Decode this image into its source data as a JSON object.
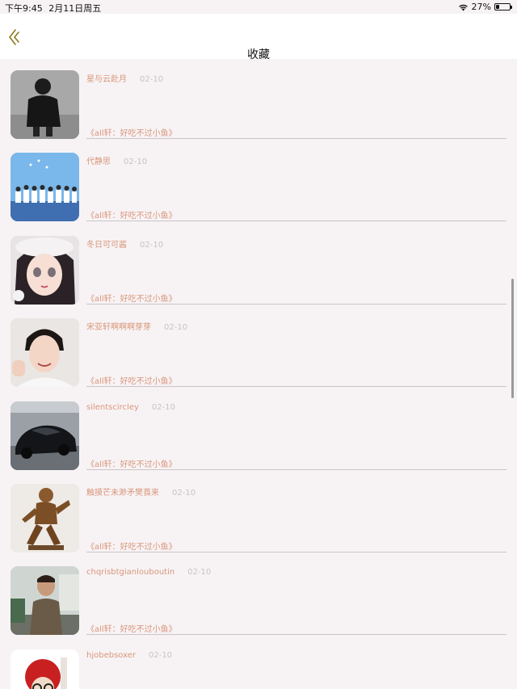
{
  "status": {
    "time": "下午9:45",
    "date": "2月11日周五",
    "battery": "27%",
    "battery_level": 0.27
  },
  "nav": {
    "title": "收藏"
  },
  "items": [
    {
      "name": "星与云赴月",
      "date": "02-10",
      "book": "《all轩：好吃不过小鱼》",
      "avatar": "person-black-shirt"
    },
    {
      "name": "代静思",
      "date": "02-10",
      "book": "《all轩：好吃不过小鱼》",
      "avatar": "group-blue-sky"
    },
    {
      "name": "冬日可可酱",
      "date": "02-10",
      "book": "《all轩：好吃不过小鱼》",
      "avatar": "anime-girl"
    },
    {
      "name": "宋亚轩啊啊啊芽芽",
      "date": "02-10",
      "book": "《all轩：好吃不过小鱼》",
      "avatar": "smiling-boy"
    },
    {
      "name": "silentscircley",
      "date": "02-10",
      "book": "《all轩：好吃不过小鱼》",
      "avatar": "black-sports-car"
    },
    {
      "name": "触摸芒未渺矛樊莨来",
      "date": "02-10",
      "book": "《all轩：好吃不过小鱼》",
      "avatar": "bronze-statue"
    },
    {
      "name": "chqrisbtgianlouboutin",
      "date": "02-10",
      "book": "《all轩：好吃不过小鱼》",
      "avatar": "man-outdoor"
    },
    {
      "name": "hjobebsoxer",
      "date": "02-10",
      "book": "",
      "avatar": "red-doll"
    }
  ]
}
